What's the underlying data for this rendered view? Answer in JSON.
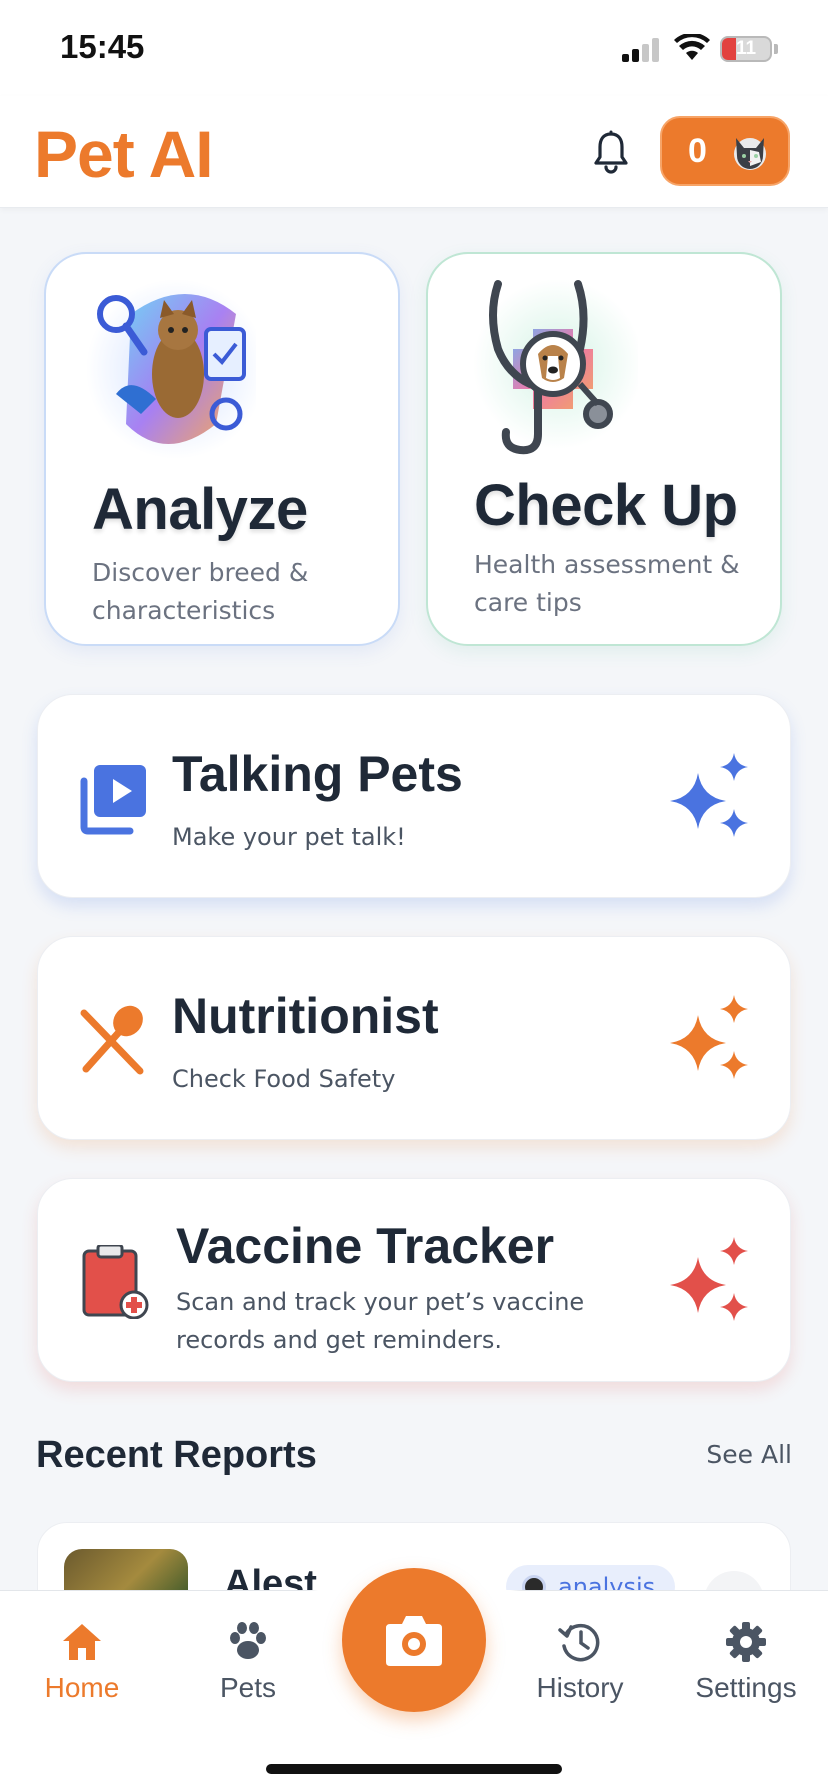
{
  "status_bar": {
    "time": "15:45",
    "battery_level": "11"
  },
  "header": {
    "brand": "Pet AI",
    "credits_count": "0"
  },
  "cards": {
    "analyze": {
      "title": "Analyze",
      "description": "Discover breed & characteristics"
    },
    "checkup": {
      "title": "Check Up",
      "description": "Health assessment & care tips"
    }
  },
  "features": {
    "talking": {
      "title": "Talking Pets",
      "description": "Make your pet talk!"
    },
    "nutrition": {
      "title": "Nutritionist",
      "description": "Check Food Safety"
    },
    "vaccine": {
      "title": "Vaccine Tracker",
      "description": "Scan and track your pet’s vaccine records and get reminders."
    }
  },
  "recent": {
    "title": "Recent Reports",
    "see_all": "See All",
    "items": [
      {
        "name": "Alest",
        "badge": "analysis"
      }
    ]
  },
  "tabs": {
    "home": "Home",
    "pets": "Pets",
    "history": "History",
    "settings": "Settings"
  },
  "colors": {
    "accent": "#ec7a2c",
    "blue": "#4a73e0",
    "red": "#e2504a",
    "text": "#1f2937"
  }
}
